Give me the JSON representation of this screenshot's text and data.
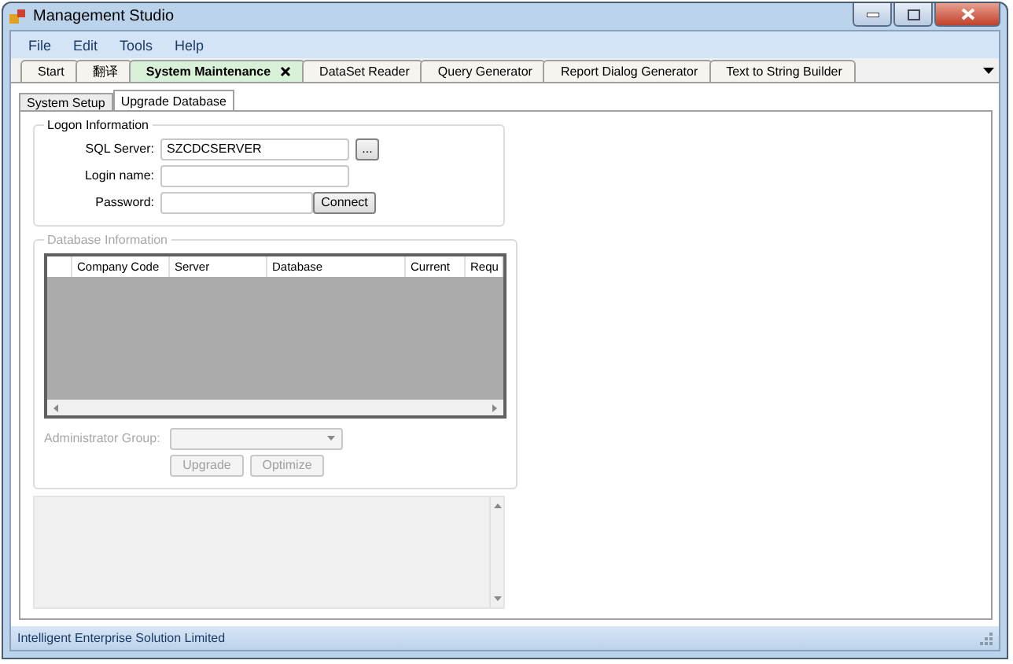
{
  "window": {
    "title": "Management Studio"
  },
  "menu": [
    "File",
    "Edit",
    "Tools",
    "Help"
  ],
  "document_tabs": [
    {
      "label": "Start",
      "selected": false,
      "closable": false
    },
    {
      "label": "翻译",
      "selected": false,
      "closable": false
    },
    {
      "label": "System Maintenance",
      "selected": true,
      "closable": true
    },
    {
      "label": "DataSet Reader",
      "selected": false,
      "closable": false
    },
    {
      "label": "Query Generator",
      "selected": false,
      "closable": false
    },
    {
      "label": "Report Dialog Generator",
      "selected": false,
      "closable": false
    },
    {
      "label": "Text to String Builder",
      "selected": false,
      "closable": false
    }
  ],
  "page_tabs": [
    {
      "label": "System Setup",
      "selected": false
    },
    {
      "label": "Upgrade Database",
      "selected": true
    }
  ],
  "logon": {
    "title": "Logon Information",
    "sql_server_label": "SQL Server:",
    "sql_server_value": "SZCDCSERVER",
    "browse_button": "...",
    "login_label": "Login name:",
    "password_label": "Password:",
    "connect_button": "Connect"
  },
  "database": {
    "title": "Database Information",
    "disabled": true,
    "columns": [
      "Company Code",
      "Server",
      "Database",
      "Current",
      "Requ"
    ],
    "admin_group_label": "Administrator Group:",
    "upgrade_button": "Upgrade",
    "optimize_button": "Optimize"
  },
  "status_bar": "Intelligent Enterprise Solution Limited"
}
